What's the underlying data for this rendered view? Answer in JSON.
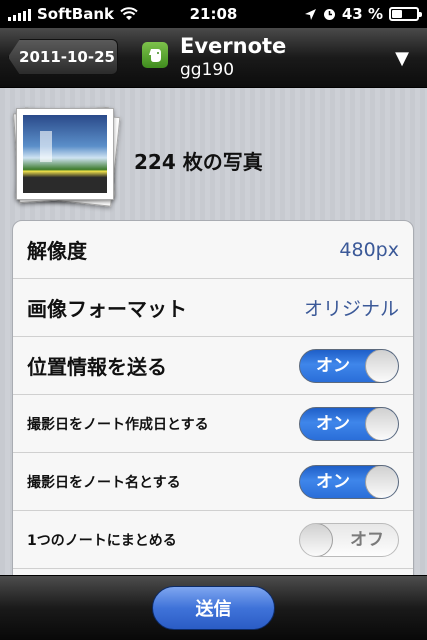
{
  "status_bar": {
    "carrier": "SoftBank",
    "time": "21:08",
    "battery": "43 %",
    "battery_level": 0.43
  },
  "nav": {
    "back_label": "2011-10-25",
    "title": "Evernote",
    "subtitle": "gg190",
    "app_icon": "evernote-elephant-icon",
    "dropdown_icon": "triangle-down-icon"
  },
  "header": {
    "photo_count_label": "224 枚の写真"
  },
  "settings": {
    "resolution_label": "解像度",
    "resolution_value": "480px",
    "format_label": "画像フォーマット",
    "format_value": "オリジナル",
    "location_label": "位置情報を送る",
    "location_toggle": "オン",
    "shoot_date_created_label": "撮影日をノート作成日とする",
    "shoot_date_created_toggle": "オン",
    "shoot_date_name_label": "撮影日をノート名とする",
    "shoot_date_name_toggle": "オン",
    "single_note_label": "1つのノートにまとめる",
    "single_note_toggle": "オフ"
  },
  "toolbar": {
    "send_label": "送信"
  },
  "colors": {
    "accent_blue": "#3f86ea",
    "value_text": "#3b5998",
    "evernote_green": "#5aa832"
  }
}
